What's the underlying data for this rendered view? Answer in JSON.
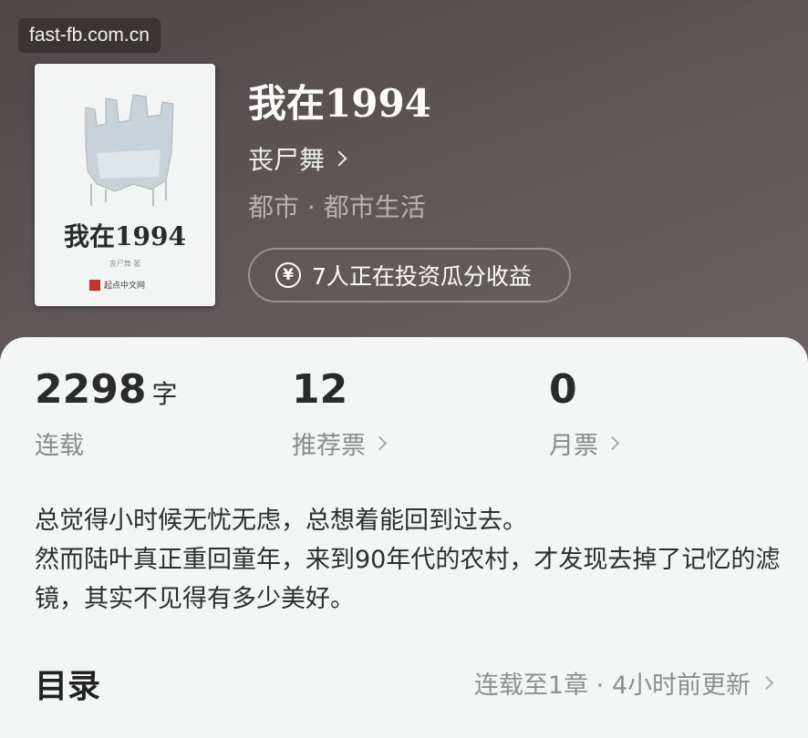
{
  "watermark": "fast-fb.com.cn",
  "cover": {
    "title": "我在1994",
    "author_small": "丧尸舞 著",
    "publisher": "起点中文网"
  },
  "book": {
    "title": "我在1994",
    "author": "丧尸舞",
    "genre": "都市 · 都市生活",
    "invest_text": "7人正在投资瓜分收益"
  },
  "stats": [
    {
      "value": "2298",
      "unit": "字",
      "label": "连载"
    },
    {
      "value": "12",
      "label": "推荐票"
    },
    {
      "value": "0",
      "label": "月票"
    }
  ],
  "synopsis": {
    "line1": "总觉得小时候无忧无虑，总想着能回到过去。",
    "line2": "然而陆叶真正重回童年，来到90年代的农村，才发现去掉了记忆的滤镜，其实不见得有多少美好。"
  },
  "toc": {
    "title": "目录",
    "meta": "连载至1章 · 4小时前更新"
  },
  "icons": [
    "yen-icon",
    "chevron-right-icon"
  ]
}
